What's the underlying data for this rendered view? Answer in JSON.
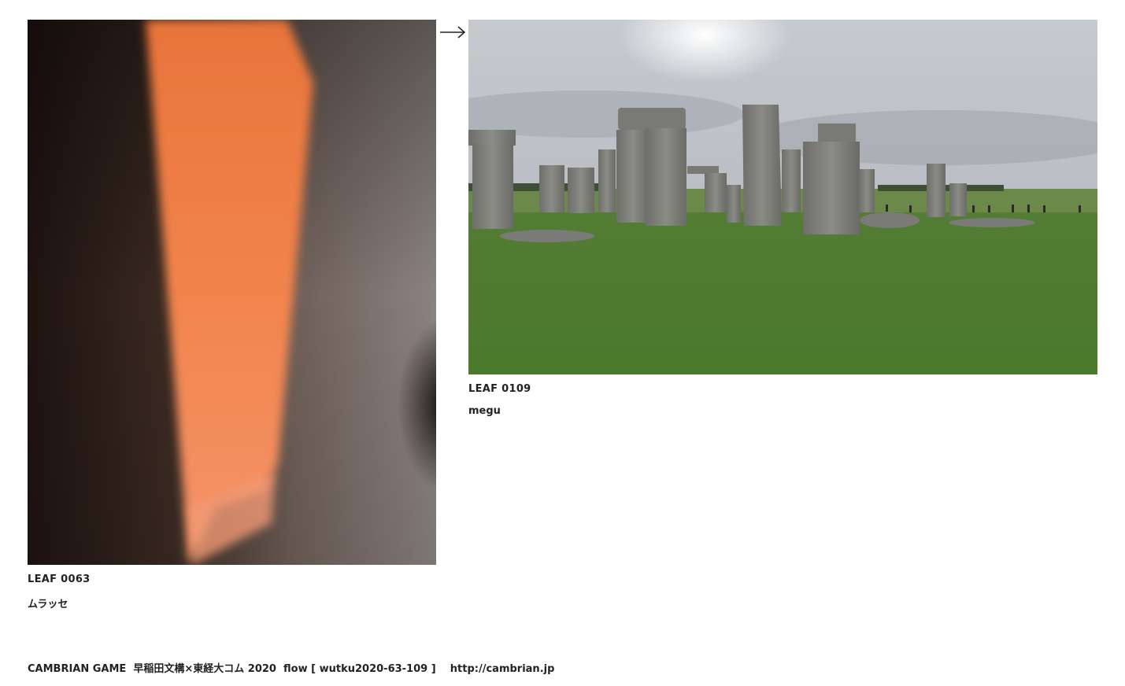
{
  "leaves": [
    {
      "title": "LEAF 0063",
      "author": "ムラッセ",
      "image": "orange-light-on-wall-photo"
    },
    {
      "title": "LEAF 0109",
      "author": "megu",
      "image": "stonehenge-photo"
    }
  ],
  "nav": {
    "arrow_icon": "right-arrow-icon"
  },
  "footer": {
    "site_name": "CAMBRIAN GAME",
    "project": "早稲田文構×東経大コム 2020",
    "flow": "flow [ wutku2020-63-109 ]",
    "url": "http://cambrian.jp"
  }
}
